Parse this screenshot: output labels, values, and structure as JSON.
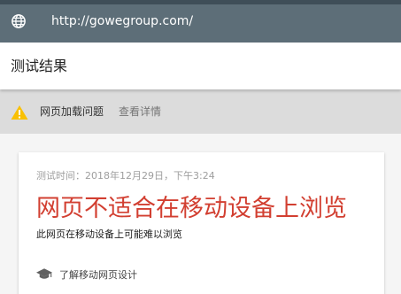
{
  "address_bar": {
    "icon": "globe-icon",
    "url": "http://gowegroup.com/"
  },
  "header": {
    "title": "测试结果"
  },
  "warning_bar": {
    "icon": "warning-icon",
    "message": "网页加载问题",
    "link": "查看详情",
    "icon_color": "#f9c003"
  },
  "result_card": {
    "test_time": "测试时间：2018年12月29日，下午3:24",
    "verdict": "网页不适合在移动设备上浏览",
    "verdict_color": "#d23f31",
    "subtitle": "此网页在移动设备上可能难以浏览",
    "learn_more": {
      "icon": "graduation-cap-icon",
      "label": "了解移动网页设计"
    }
  }
}
